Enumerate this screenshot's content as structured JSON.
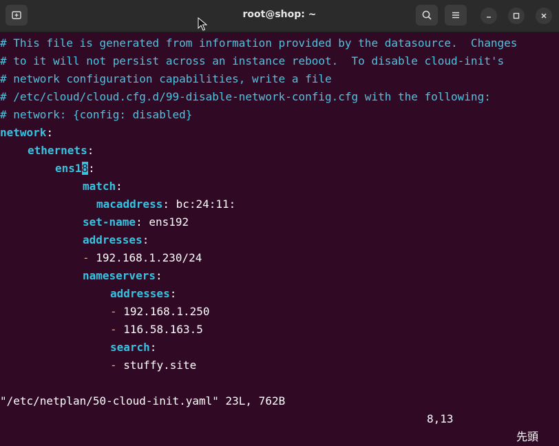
{
  "window": {
    "title": "root@shop: ~",
    "icons": [
      "new-tab-icon",
      "search-icon",
      "hamburger-menu-icon",
      "minimize-icon",
      "maximize-icon",
      "close-icon"
    ]
  },
  "editor": {
    "comments": [
      "# This file is generated from information provided by the datasource.  Changes",
      "# to it will not persist across an instance reboot.  To disable cloud-init's",
      "# network configuration capabilities, write a file",
      "# /etc/cloud/cloud.cfg.d/99-disable-network-config.cfg with the following:",
      "# network: {config: disabled}"
    ],
    "network_key": "network",
    "ethernets_key": "ethernets",
    "iface_prefix": "ens1",
    "iface_cursor_char": "8",
    "match_key": "match",
    "macaddress_key": "macaddress",
    "macaddress_value": "bc:24:11:",
    "setname_key": "set-name",
    "setname_value": "ens192",
    "addresses_key": "addresses",
    "address_1": "192.168.1.230/24",
    "nameservers_key": "nameservers",
    "ns_addresses_key": "addresses",
    "ns_1": "192.168.1.250",
    "ns_2": "116.58.163.5",
    "search_key": "search",
    "search_1": "stuffy.site",
    "colon": ":",
    "dash": "-"
  },
  "status": {
    "file": "\"/etc/netplan/50-cloud-init.yaml\" 23L, 762B",
    "position": "8,13",
    "scroll": "先頭"
  },
  "colors": {
    "background": "#300a24",
    "comment": "#4fc3e0",
    "key": "#34c4e2",
    "dash": "#ffa348",
    "titlebar": "#2b2b2b"
  }
}
